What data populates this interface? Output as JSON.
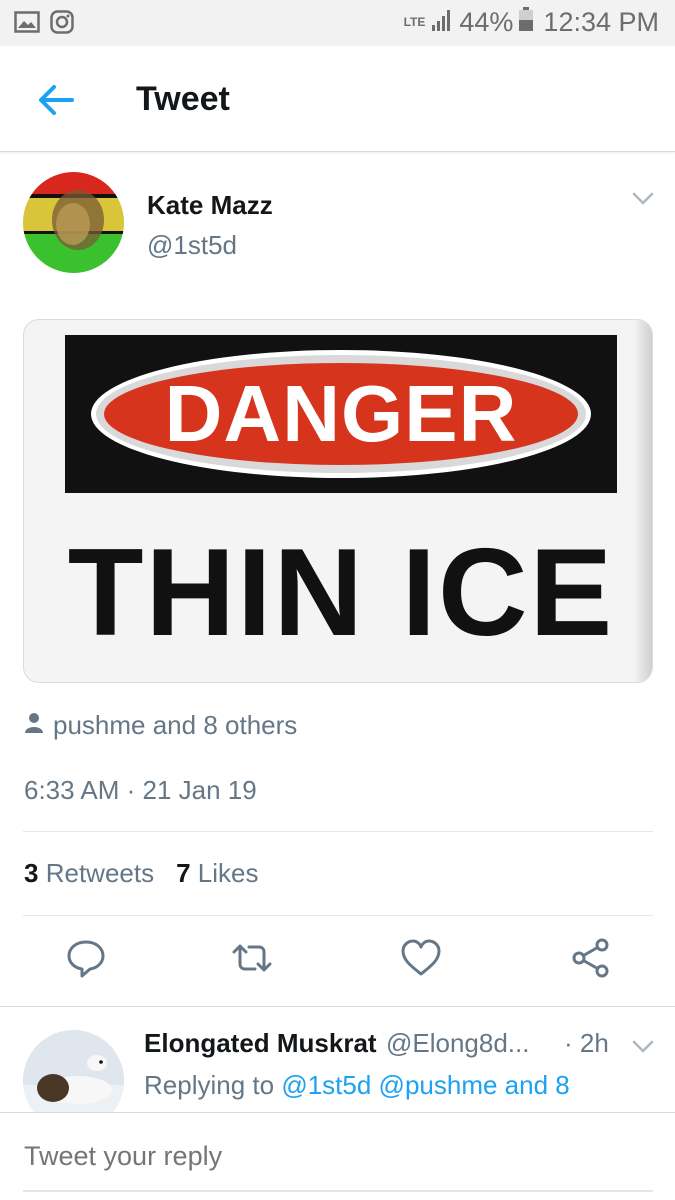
{
  "status_bar": {
    "network": "LTE",
    "battery": "44%",
    "time": "12:34 PM",
    "icons": [
      "image-icon",
      "instagram-icon",
      "signal-icon",
      "battery-icon"
    ]
  },
  "header": {
    "title": "Tweet",
    "back_icon": "arrow-left-icon"
  },
  "tweet": {
    "author_name": "Kate Mazz",
    "author_handle": "@1st5d",
    "media": {
      "sign_top": "DANGER",
      "sign_bottom": "THIN ICE"
    },
    "reply_context": "pushme and 8 others",
    "timestamp": "6:33 AM · 21 Jan 19",
    "retweets_count": "3",
    "retweets_label": "Retweets",
    "likes_count": "7",
    "likes_label": "Likes",
    "actions": [
      "reply-icon",
      "retweet-icon",
      "like-icon",
      "share-icon"
    ]
  },
  "reply": {
    "author_name": "Elongated Muskrat",
    "author_handle": "@Elong8d...",
    "time": "· 2h",
    "replying_prefix": "Replying to",
    "mention_1": "@1st5d",
    "mention_2": "@pushme and 8"
  },
  "composer": {
    "placeholder": "Tweet your reply"
  },
  "colors": {
    "accent": "#1da1f2",
    "text": "#14171a",
    "secondary": "#657786",
    "danger_red": "#d7341e"
  }
}
